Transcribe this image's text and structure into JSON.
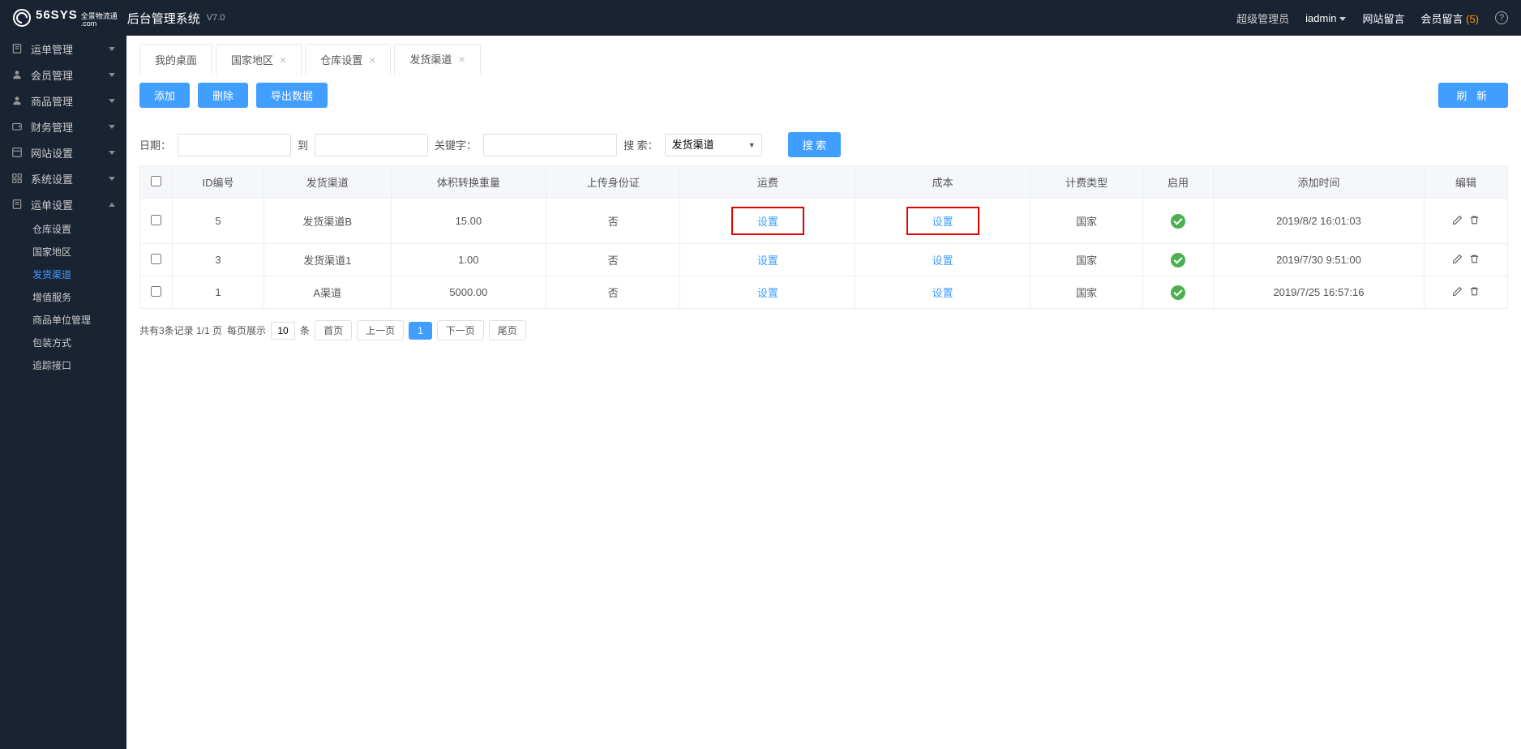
{
  "header": {
    "logo_text": "56SYS",
    "logo_sub1": "全景物流通",
    "logo_sub2": ".com",
    "title": "后台管理系统",
    "version": "V7.0",
    "role": "超级管理员",
    "username": "iadmin",
    "site_msg": "网站留言",
    "member_msg_label": "会员留言",
    "member_msg_count": "(5)"
  },
  "sidebar": {
    "items": [
      {
        "label": "运单管理",
        "icon": "document-icon",
        "expanded": false
      },
      {
        "label": "会员管理",
        "icon": "user-icon",
        "expanded": false
      },
      {
        "label": "商品管理",
        "icon": "user-icon",
        "expanded": false
      },
      {
        "label": "财务管理",
        "icon": "wallet-icon",
        "expanded": false
      },
      {
        "label": "网站设置",
        "icon": "layout-icon",
        "expanded": false
      },
      {
        "label": "系统设置",
        "icon": "grid-icon",
        "expanded": false
      },
      {
        "label": "运单设置",
        "icon": "document-icon",
        "expanded": true
      }
    ],
    "submenu": [
      {
        "label": "仓库设置",
        "active": false
      },
      {
        "label": "国家地区",
        "active": false
      },
      {
        "label": "发货渠道",
        "active": true
      },
      {
        "label": "增值服务",
        "active": false
      },
      {
        "label": "商品单位管理",
        "active": false
      },
      {
        "label": "包装方式",
        "active": false
      },
      {
        "label": "追踪接口",
        "active": false
      }
    ]
  },
  "tabs": [
    {
      "label": "我的桌面",
      "closable": false,
      "active": false
    },
    {
      "label": "国家地区",
      "closable": true,
      "active": false
    },
    {
      "label": "仓库设置",
      "closable": true,
      "active": false
    },
    {
      "label": "发货渠道",
      "closable": true,
      "active": true
    }
  ],
  "toolbar": {
    "add": "添加",
    "delete": "删除",
    "export": "导出数据",
    "refresh": "刷 新"
  },
  "filters": {
    "date_label": "日期：",
    "date_to": "到",
    "keyword_label": "关键字：",
    "search_by_label": "搜 索：",
    "search_by_value": "发货渠道",
    "search_btn": "搜 索"
  },
  "table": {
    "headers": [
      "",
      "ID编号",
      "发货渠道",
      "体积转换重量",
      "上传身份证",
      "运费",
      "成本",
      "计费类型",
      "启用",
      "添加时间",
      "编辑"
    ],
    "rows": [
      {
        "id": "5",
        "channel": "发货渠道B",
        "weight": "15.00",
        "idcard": "否",
        "freight": "设置",
        "cost": "设置",
        "billing": "国家",
        "enabled": true,
        "time": "2019/8/2 16:01:03",
        "highlight": true
      },
      {
        "id": "3",
        "channel": "发货渠道1",
        "weight": "1.00",
        "idcard": "否",
        "freight": "设置",
        "cost": "设置",
        "billing": "国家",
        "enabled": true,
        "time": "2019/7/30 9:51:00",
        "highlight": false
      },
      {
        "id": "1",
        "channel": "A渠道",
        "weight": "5000.00",
        "idcard": "否",
        "freight": "设置",
        "cost": "设置",
        "billing": "国家",
        "enabled": true,
        "time": "2019/7/25 16:57:16",
        "highlight": false
      }
    ]
  },
  "pagination": {
    "summary": "共有3条记录  1/1 页",
    "per_page_label": "每页展示",
    "per_page_value": "10",
    "per_page_unit": "条",
    "first": "首页",
    "prev": "上一页",
    "current": "1",
    "next": "下一页",
    "last": "尾页"
  }
}
